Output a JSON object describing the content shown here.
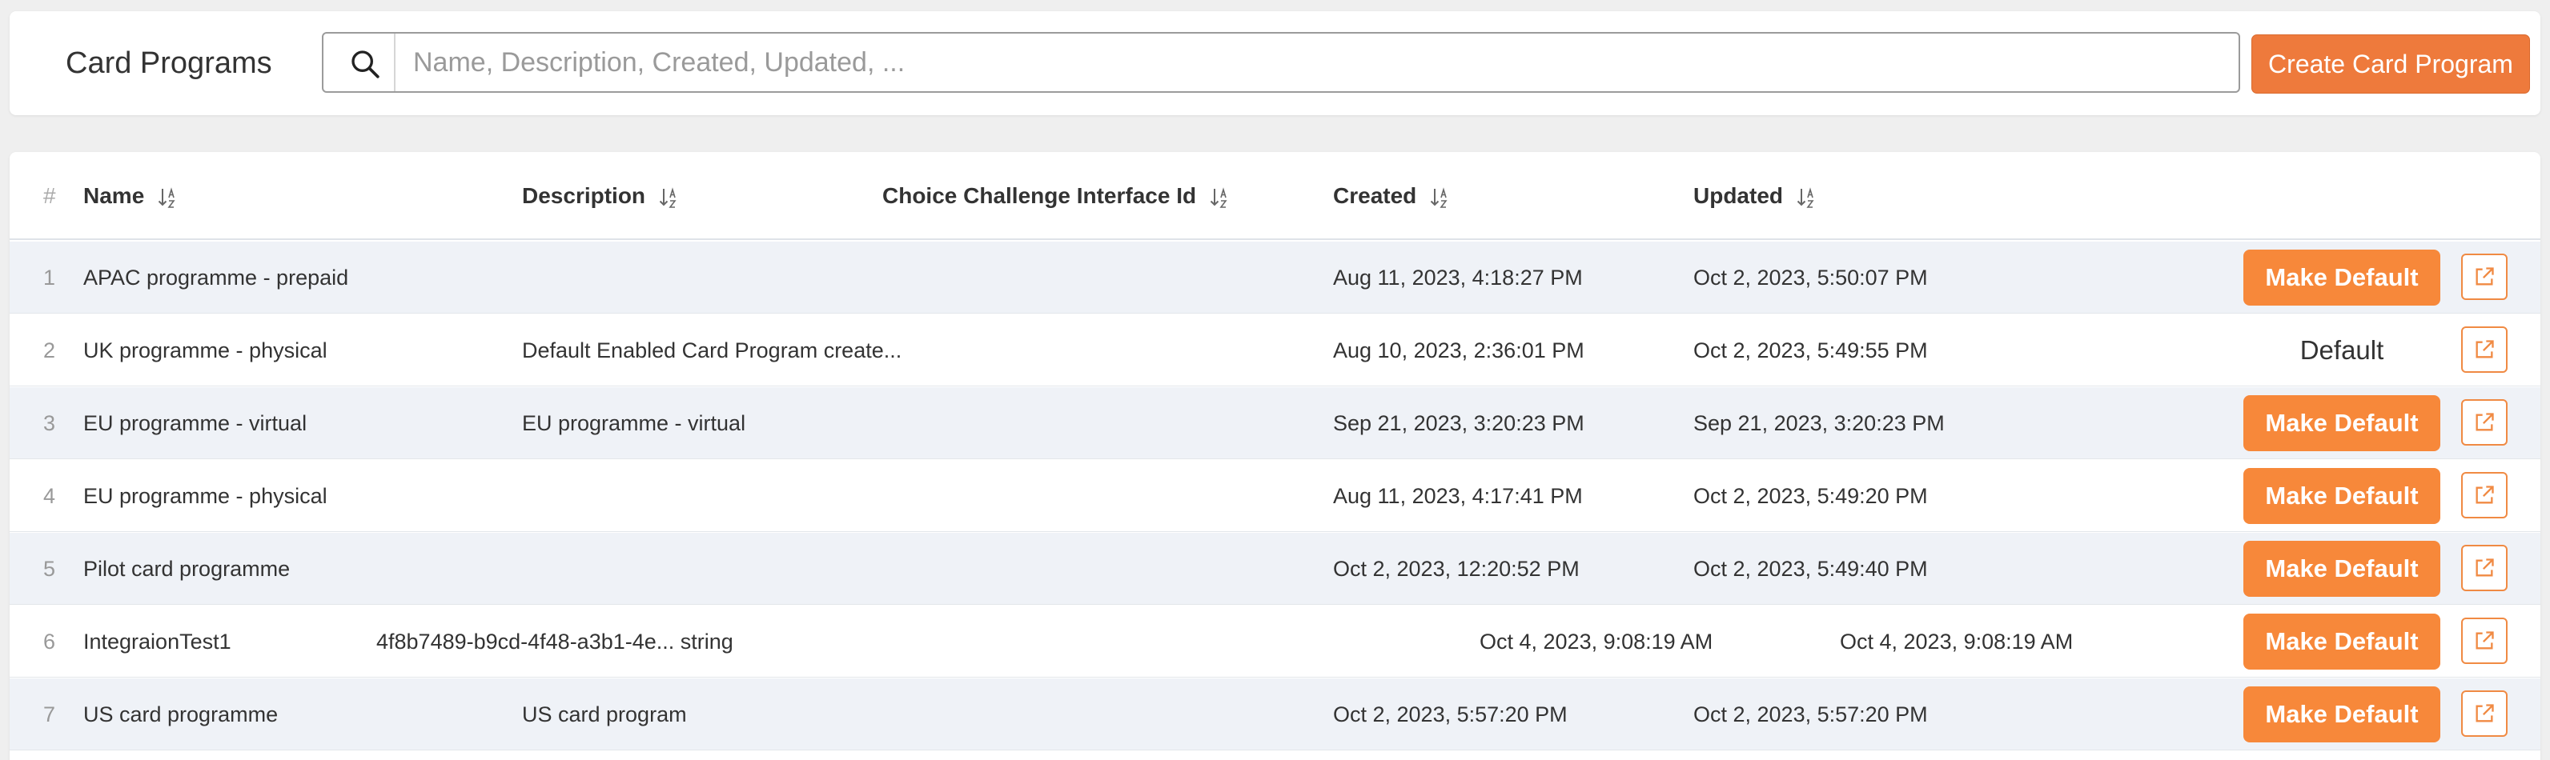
{
  "header": {
    "title": "Card Programs",
    "search_placeholder": "Name, Description, Created, Updated, ...",
    "create_button_label": "Create Card Program"
  },
  "table": {
    "columns": {
      "index": "#",
      "name": "Name",
      "description": "Description",
      "challenge": "Choice Challenge Interface Id",
      "created": "Created",
      "updated": "Updated"
    },
    "make_default_label": "Make Default",
    "default_label": "Default",
    "rows": [
      {
        "index": "1",
        "name": "APAC programme - prepaid",
        "description": "",
        "challenge": "",
        "created": "Aug 11, 2023, 4:18:27 PM",
        "updated": "Oct 2, 2023, 5:50:07 PM",
        "is_default": false
      },
      {
        "index": "2",
        "name": "UK programme - physical",
        "description": "Default Enabled Card Program create...",
        "challenge": "",
        "created": "Aug 10, 2023, 2:36:01 PM",
        "updated": "Oct 2, 2023, 5:49:55 PM",
        "is_default": true
      },
      {
        "index": "3",
        "name": "EU programme - virtual",
        "description": "EU programme - virtual",
        "challenge": "",
        "created": "Sep 21, 2023, 3:20:23 PM",
        "updated": "Sep 21, 2023, 3:20:23 PM",
        "is_default": false
      },
      {
        "index": "4",
        "name": "EU programme - physical",
        "description": "",
        "challenge": "",
        "created": "Aug 11, 2023, 4:17:41 PM",
        "updated": "Oct 2, 2023, 5:49:20 PM",
        "is_default": false
      },
      {
        "index": "5",
        "name": "Pilot card programme",
        "description": "",
        "challenge": "",
        "created": "Oct 2, 2023, 12:20:52 PM",
        "updated": "Oct 2, 2023, 5:49:40 PM",
        "is_default": false
      },
      {
        "index": "6",
        "name": "IntegraionTest1",
        "description": "4f8b7489-b9cd-4f48-a3b1-4e... string",
        "challenge": "",
        "created": "Oct 4, 2023, 9:08:19 AM",
        "updated": "Oct 4, 2023, 9:08:19 AM",
        "is_default": false
      },
      {
        "index": "7",
        "name": "US card programme",
        "description": "US card program",
        "challenge": "",
        "created": "Oct 2, 2023, 5:57:20 PM",
        "updated": "Oct 2, 2023, 5:57:20 PM",
        "is_default": false
      }
    ]
  },
  "colors": {
    "accent": "#f7883a",
    "create_button": "#ee7a3c",
    "row_striped": "#eff2f7"
  },
  "icons": {
    "search": "search-icon",
    "sort": "sort-icon",
    "open": "external-link-icon"
  }
}
